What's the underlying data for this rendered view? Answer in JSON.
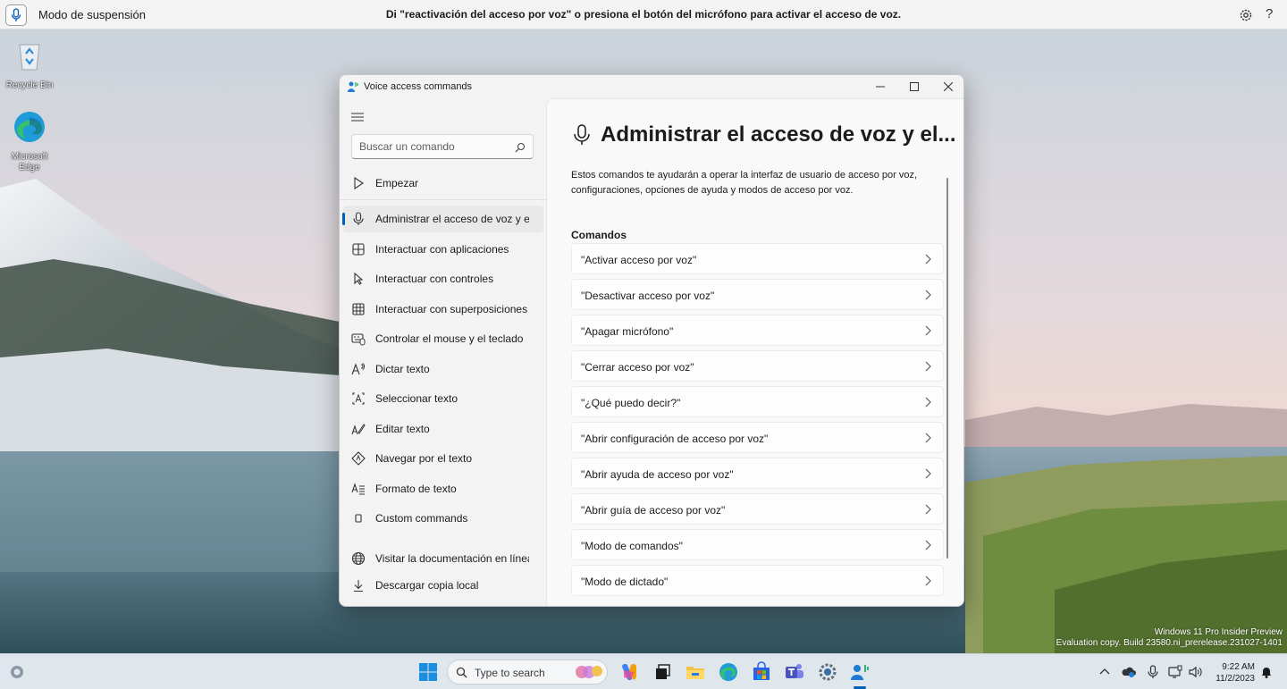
{
  "voice_bar": {
    "status": "Modo de suspensión",
    "hint": "Di \"reactivación del acceso por voz\" o presiona el botón del micrófono para activar el acceso de voz."
  },
  "desktop": {
    "icons": [
      {
        "label": "Recycle Bin"
      },
      {
        "label": "Microsoft Edge"
      }
    ]
  },
  "window": {
    "title": "Voice access commands",
    "search_placeholder": "Buscar un comando",
    "nav": [
      {
        "label": "Empezar",
        "icon": "play-outline-icon"
      },
      {
        "label": "Administrar el acceso de voz y el",
        "icon": "microphone-icon",
        "selected": true
      },
      {
        "label": "Interactuar con aplicaciones",
        "icon": "apps-grid-icon"
      },
      {
        "label": "Interactuar con controles",
        "icon": "cursor-icon"
      },
      {
        "label": "Interactuar con superposiciones",
        "icon": "grid-overlay-icon"
      },
      {
        "label": "Controlar el mouse y el teclado",
        "icon": "keyboard-mouse-icon"
      },
      {
        "label": "Dictar texto",
        "icon": "dictate-text-icon"
      },
      {
        "label": "Seleccionar texto",
        "icon": "select-text-icon"
      },
      {
        "label": "Editar texto",
        "icon": "edit-text-icon"
      },
      {
        "label": "Navegar por el texto",
        "icon": "navigate-text-icon"
      },
      {
        "label": "Formato de texto",
        "icon": "format-text-icon"
      },
      {
        "label": "Custom commands",
        "icon": "custom-commands-icon"
      },
      {
        "label": "Visitar la documentación en línea",
        "icon": "globe-icon"
      },
      {
        "label": "Descargar copia local",
        "icon": "download-icon"
      }
    ],
    "content": {
      "title": "Administrar el acceso de voz y el...",
      "description": "Estos comandos te ayudarán a operar la interfaz de usuario de acceso por voz, configuraciones, opciones de ayuda y modos de acceso por voz.",
      "section": "Comandos",
      "commands": [
        "\"Activar acceso por voz\"",
        "\"Desactivar acceso por voz\"",
        "\"Apagar micrófono\"",
        "\"Cerrar acceso por voz\"",
        "\"¿Qué puedo decir?\"",
        "\"Abrir configuración de acceso por voz\"",
        "\"Abrir ayuda de acceso por voz\"",
        "\"Abrir guía de acceso por voz\"",
        "\"Modo de comandos\"",
        "\"Modo de dictado\""
      ]
    }
  },
  "watermark": {
    "line1": "Windows 11 Pro Insider Preview",
    "line2": "Evaluation copy. Build 23580.ni_prerelease.231027-1401"
  },
  "taskbar": {
    "search_placeholder": "Type to search",
    "time": "9:22 AM",
    "date": "11/2/2023"
  },
  "colors": {
    "accent": "#005fb8",
    "window_bg": "#f3f3f3",
    "content_bg": "#f9f9f9",
    "taskbar_bg": "#dfe6ec"
  }
}
